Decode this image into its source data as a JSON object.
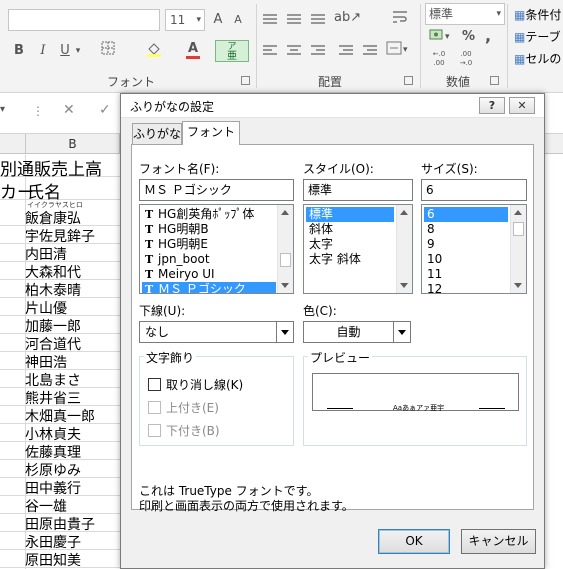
{
  "ribbon": {
    "font_size": "11",
    "grow_font": "A",
    "shrink_font": "A",
    "bold": "B",
    "italic": "I",
    "underline": "U",
    "font_color_letter": "A",
    "phonetic_letter": "ア",
    "phonetic_sub": "亜",
    "number_format": "標準",
    "percent": "%",
    "comma": ",",
    "decimal_inc": "←.0 .00",
    "decimal_dec": ".00 →.0",
    "groups": {
      "font": "フォント",
      "alignment": "配置",
      "number": "数値"
    },
    "right_items": [
      "条件付",
      "テーブ",
      "セルの"
    ]
  },
  "sheet": {
    "column_b": "B",
    "title": "別通販売上高",
    "header_a": "カー",
    "header_b": "氏名",
    "first_furigana": "イイクラヤスヒロ",
    "names": [
      "飯倉康弘",
      "宇佐見鉾子",
      "内田清",
      "大森和代",
      "柏木泰晴",
      "片山優",
      "加藤一郎",
      "河合道代",
      "神田浩",
      "北島まさ",
      "熊井省三",
      "木畑真一郎",
      "小林貞夫",
      "佐藤真理",
      "杉原ゆみ",
      "田中義行",
      "谷一雄",
      "田原由貴子",
      "永田慶子",
      "原田知美"
    ]
  },
  "dialog": {
    "title": "ふりがなの設定",
    "help_btn": "?",
    "close_btn": "✕",
    "tabs": [
      "ふりがな",
      "フォント"
    ],
    "font_name_label": "フォント名(F):",
    "font_name_value": "ＭＳ Ｐゴシック",
    "font_list": [
      "HG創英角ﾎﾟｯﾌﾟ体",
      "HG明朝B",
      "HG明朝E",
      "jpn_boot",
      "Meiryo UI",
      "ＭＳ Ｐゴシック"
    ],
    "style_label": "スタイル(O):",
    "style_value": "標準",
    "style_list": [
      "標準",
      "斜体",
      "太字",
      "太字 斜体"
    ],
    "size_label": "サイズ(S):",
    "size_value": "6",
    "size_list": [
      "6",
      "8",
      "9",
      "10",
      "11",
      "12"
    ],
    "underline_label": "下線(U):",
    "underline_value": "なし",
    "color_label": "色(C):",
    "color_value": "自動",
    "effects_label": "文字飾り",
    "strikethrough": "取り消し線(K)",
    "superscript": "上付き(E)",
    "subscript": "下付き(B)",
    "preview_label": "プレビュー",
    "preview_text": "Aaあぁアァ亜宇",
    "info_line1": "これは TrueType フォントです。",
    "info_line2": "印刷と画面表示の両方で使用されます。",
    "ok": "OK",
    "cancel": "キャンセル"
  },
  "colors": {
    "selection": "#3399ff",
    "phonetic_button": "#d6efd7"
  }
}
